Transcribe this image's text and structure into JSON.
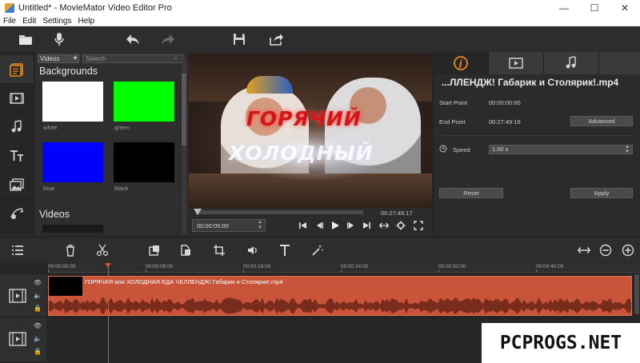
{
  "window": {
    "title": "Untitled* - MovieMator Video Editor Pro",
    "minimize": "—",
    "maximize": "☐",
    "close": "✕"
  },
  "menu": [
    "File",
    "Edit",
    "Settings",
    "Help"
  ],
  "toolbar": {
    "icons": [
      "open-folder-icon",
      "microphone-icon",
      "undo-icon",
      "redo-icon",
      "save-icon",
      "export-icon"
    ]
  },
  "sidebar": {
    "icons": [
      "media-library-icon",
      "filter-icon",
      "audio-icon",
      "text-icon",
      "overlay-icon",
      "transition-icon"
    ]
  },
  "media": {
    "filter_value": "Videos",
    "search_placeholder": "Search",
    "section_backgrounds": "Backgrounds",
    "section_videos": "Videos",
    "items": [
      {
        "label": "white",
        "color": "#ffffff"
      },
      {
        "label": "green",
        "color": "#00ff00"
      },
      {
        "label": "blue",
        "color": "#0000ff"
      },
      {
        "label": "black",
        "color": "#000000"
      }
    ]
  },
  "preview": {
    "overlay_text_1": "ГОРЯЧИЙ",
    "overlay_text_2": "ХОЛОДНЫЙ",
    "total_time": "00:27:49:17",
    "current_time": "00:00:05:00",
    "progress": 0.01
  },
  "properties": {
    "tabs": [
      "info-icon",
      "video-icon",
      "audio-icon"
    ],
    "clip_title": "...ЛЛЕНДЖ! Габарик и Столярик!.mp4",
    "start_point_label": "Start Point",
    "start_point_value": "00:00:00:00",
    "end_point_label": "End Point",
    "end_point_value": "00:27:49:16",
    "advanced_label": "Advanced",
    "speed_label": "Speed",
    "speed_value": "1,00 x",
    "reset_label": "Reset",
    "apply_label": "Apply"
  },
  "timeline": {
    "ruler_labels": [
      "00:00:00:00",
      "00:00:08:00",
      "00:00:16:00",
      "00:00:24:00",
      "00:00:32:00",
      "00:00:40:00"
    ],
    "clip_name": "ГОРЯЧАЯ или ХОЛОДНАЯ ЕДА ЧЕЛЛЕНДЖ! Габарик и Столярик!.mp4",
    "clip_color": "#c9543a"
  },
  "watermark": "PCPROGS.NET"
}
